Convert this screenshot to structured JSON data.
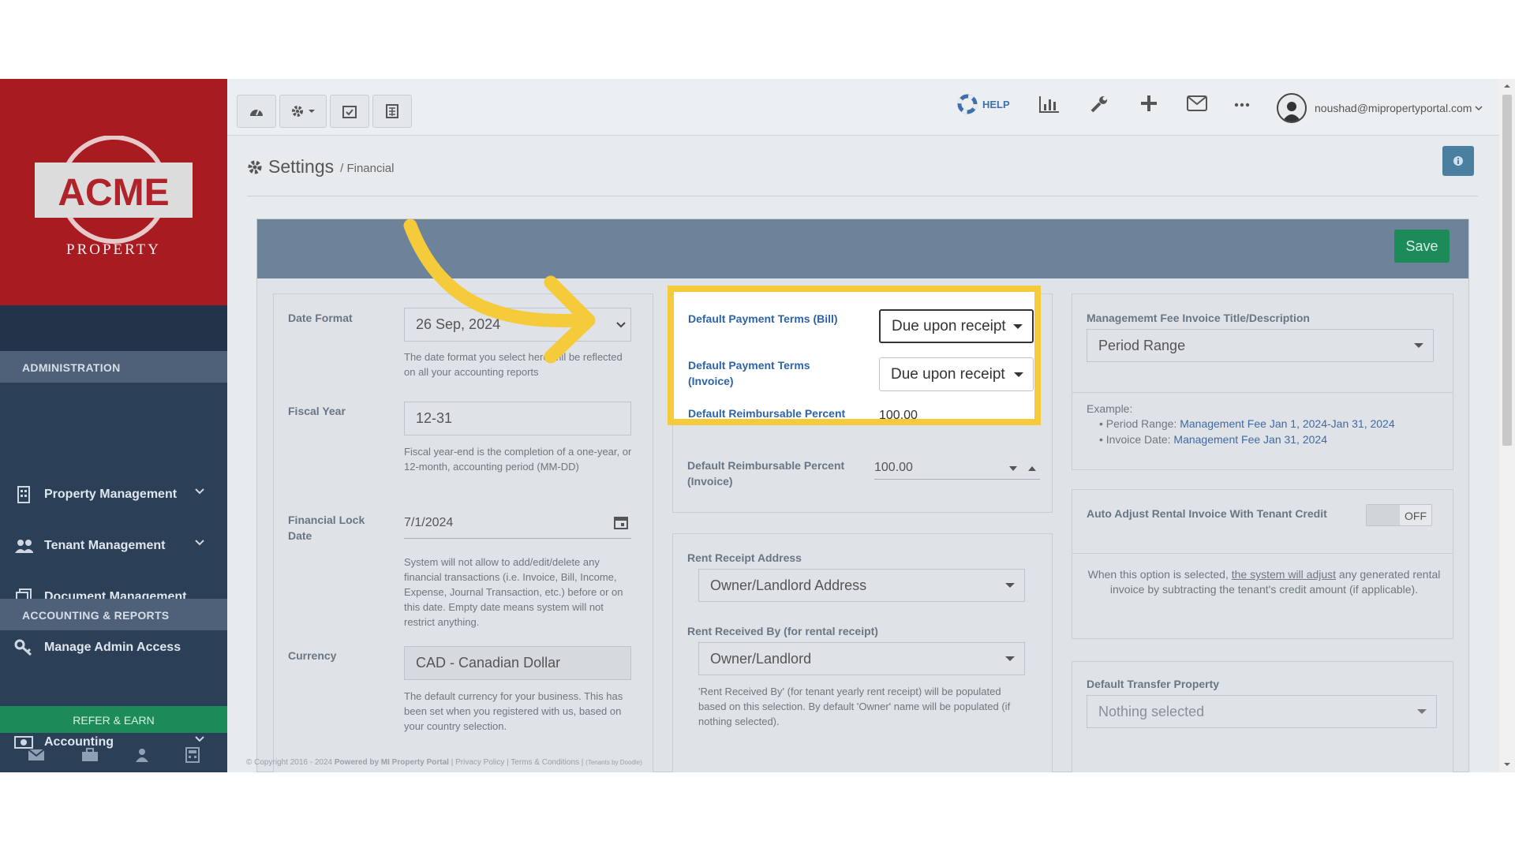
{
  "sidebar": {
    "logo_text": "ACME",
    "logo_sub": "PROPERTY",
    "sections": [
      "ADMINISTRATION",
      "ACCOUNTING & REPORTS"
    ],
    "items": [
      {
        "label": "Property Management",
        "icon": "building-icon"
      },
      {
        "label": "Tenant Management",
        "icon": "users-icon"
      },
      {
        "label": "Document Management",
        "icon": "document-icon"
      },
      {
        "label": "Manage Admin Access",
        "icon": "key-icon"
      },
      {
        "label": "Accounting",
        "icon": "money-icon"
      }
    ],
    "refer": "REFER & EARN",
    "footer_icons": [
      "mail-icon",
      "briefcase-icon",
      "user-icon",
      "calculator-icon"
    ]
  },
  "topbar": {
    "help": "HELP",
    "user_email": "noushad@mipropertyportal.com"
  },
  "page": {
    "title": "Settings",
    "crumb": "/ Financial",
    "save": "Save"
  },
  "left": {
    "date_format_label": "Date Format",
    "date_format_value": "26 Sep, 2024",
    "date_format_hint": "The date format you select here will be reflected on all your accounting reports",
    "fiscal_label": "Fiscal Year",
    "fiscal_value": "12-31",
    "fiscal_hint": "Fiscal year-end is the completion of a one-year, or 12-month, accounting period (MM-DD)",
    "lock_label": "Financial Lock Date",
    "lock_value": "7/1/2024",
    "lock_hint": "System will not allow to add/edit/delete any financial transactions (i.e. Invoice, Bill, Income, Expense, Journal Transaction, etc.) before or on this date. Empty date means system will not restrict anything.",
    "currency_label": "Currency",
    "currency_value": "CAD - Canadian Dollar",
    "currency_hint": "The default currency for your business. This has been set when you registered with us, based on your country selection."
  },
  "middle": {
    "terms_bill_label": "Default Payment Terms (Bill)",
    "terms_bill_value": "Due upon receipt",
    "terms_invoice_label": "Default Payment Terms (Invoice)",
    "terms_invoice_value": "Due upon receipt",
    "reimb_bill_label": "Default Reimbursable Percent (Bill)",
    "reimb_bill_value": "100.00",
    "reimb_invoice_label": "Default Reimbursable Percent (Invoice)",
    "reimb_invoice_value": "100.00",
    "rent_addr_label": "Rent Receipt Address",
    "rent_addr_value": "Owner/Landlord Address",
    "rent_by_label": "Rent Received By (for rental receipt)",
    "rent_by_value": "Owner/Landlord",
    "rent_by_hint": "'Rent Received By' (for tenant yearly rent receipt) will be populated based on this selection. By default 'Owner' name will be populated (if nothing selected)."
  },
  "right": {
    "mgmt_label": "Managememt Fee Invoice Title/Description",
    "mgmt_value": "Period Range",
    "example": "Example:",
    "ex1_key": "Period Range:",
    "ex1_val": "Management Fee Jan 1, 2024-Jan 31, 2024",
    "ex2_key": "Invoice Date:",
    "ex2_val": "Management Fee Jan 31, 2024",
    "auto_label": "Auto Adjust Rental Invoice With Tenant Credit",
    "auto_toggle": "OFF",
    "auto_hint_a": "When this option is selected,",
    "auto_hint_link": "the system will adjust",
    "auto_hint_b": "any generated rental invoice by subtracting the tenant's credit amount (if applicable).",
    "transfer_label": "Default Transfer Property",
    "transfer_value": "Nothing selected"
  },
  "footer": {
    "copyright": "© Copyright 2016 - 2024",
    "powered": "Powered by MI Property Portal",
    "links": "| Privacy Policy | Terms & Conditions |",
    "tenant": "(Tenants by Doodle)"
  },
  "colors": {
    "brand_red": "#a81b20",
    "sidebar": "#2b3f57",
    "save_green": "#1d8a5a",
    "highlight": "#f5cb3c"
  }
}
